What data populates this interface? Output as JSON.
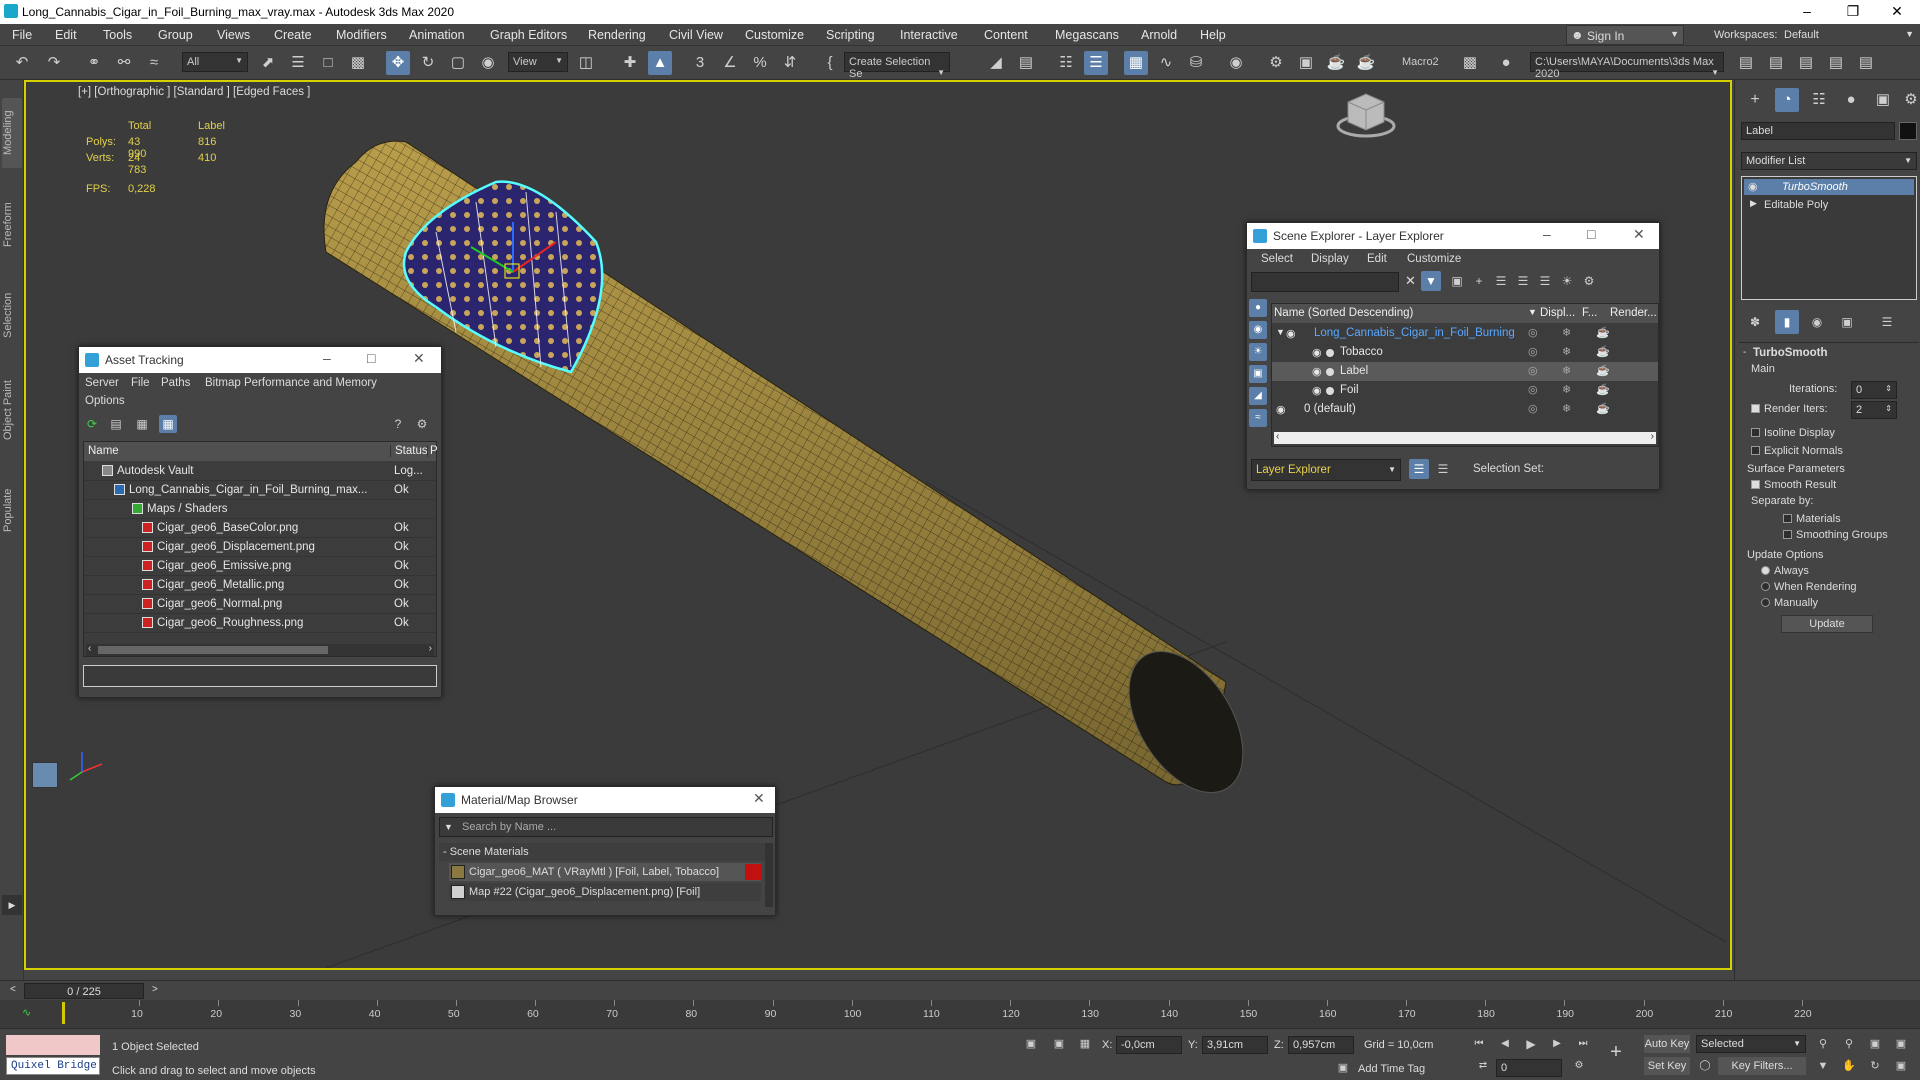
{
  "titlebar": {
    "title": "Long_Cannabis_Cigar_in_Foil_Burning_max_vray.max - Autodesk 3ds Max 2020"
  },
  "menubar": {
    "items": [
      "File",
      "Edit",
      "Tools",
      "Group",
      "Views",
      "Create",
      "Modifiers",
      "Animation",
      "Graph Editors",
      "Rendering",
      "Civil View",
      "Customize",
      "Scripting",
      "Interactive",
      "Content",
      "Megascans",
      "Arnold",
      "Help"
    ],
    "sign_in": "Sign In",
    "workspaces_label": "Workspaces:",
    "workspace_value": "Default"
  },
  "toolbar": {
    "filter_value": "All",
    "ref_coord": "View",
    "selection_set": "Create Selection Se",
    "macro": "Macro2",
    "path": "C:\\Users\\MAYA\\Documents\\3ds Max 2020"
  },
  "left_tabs": [
    "Modeling",
    "Freeform",
    "Selection",
    "Object Paint",
    "Populate"
  ],
  "viewport": {
    "label": "[+] [Orthographic ] [Standard ] [Edged Faces ]",
    "stats": {
      "total_label": "Total",
      "label_label": "Label",
      "polys_label": "Polys:",
      "polys_total": "43 990",
      "polys_label_val": "816",
      "verts_label": "Verts:",
      "verts_total": "24 783",
      "verts_label_val": "410",
      "fps_label": "FPS:",
      "fps_value": "0,228"
    }
  },
  "asset_tracking": {
    "title": "Asset Tracking",
    "menu": [
      "Server",
      "File",
      "Paths",
      "Bitmap Performance and Memory",
      "Options"
    ],
    "columns": [
      "Name",
      "Status",
      "P"
    ],
    "rows": [
      {
        "name": "Autodesk Vault",
        "status": "Log..."
      },
      {
        "name": "Long_Cannabis_Cigar_in_Foil_Burning_max...",
        "status": "Ok"
      },
      {
        "name": "Maps / Shaders",
        "status": ""
      },
      {
        "name": "Cigar_geo6_BaseColor.png",
        "status": "Ok"
      },
      {
        "name": "Cigar_geo6_Displacement.png",
        "status": "Ok"
      },
      {
        "name": "Cigar_geo6_Emissive.png",
        "status": "Ok"
      },
      {
        "name": "Cigar_geo6_Metallic.png",
        "status": "Ok"
      },
      {
        "name": "Cigar_geo6_Normal.png",
        "status": "Ok"
      },
      {
        "name": "Cigar_geo6_Roughness.png",
        "status": "Ok"
      }
    ]
  },
  "scene_explorer": {
    "title": "Scene Explorer - Layer Explorer",
    "menu": [
      "Select",
      "Display",
      "Edit",
      "Customize"
    ],
    "columns": [
      "Name (Sorted Descending)",
      "Displ...",
      "F...",
      "Render..."
    ],
    "rows": [
      {
        "name": "Long_Cannabis_Cigar_in_Foil_Burning"
      },
      {
        "name": "Tobacco"
      },
      {
        "name": "Label"
      },
      {
        "name": "Foil"
      },
      {
        "name": "0 (default)"
      }
    ],
    "footer_layer": "Layer Explorer",
    "selection_set_label": "Selection Set:"
  },
  "material_browser": {
    "title": "Material/Map Browser",
    "search_placeholder": "Search by Name ...",
    "section": "- Scene Materials",
    "items": [
      "Cigar_geo6_MAT  ( VRayMtl )  [Foil, Label, Tobacco]",
      "Map #22 (Cigar_geo6_Displacement.png) [Foil]"
    ]
  },
  "right_panel": {
    "object_name": "Label",
    "modifier_list": "Modifier List",
    "stack": [
      "TurboSmooth",
      "Editable Poly"
    ],
    "rollout_title": "TurboSmooth",
    "main_label": "Main",
    "iterations_label": "Iterations:",
    "iterations_value": "0",
    "render_iters_label": "Render Iters:",
    "render_iters_value": "2",
    "isoline": "Isoline Display",
    "explicit_normals": "Explicit Normals",
    "surface_params": "Surface Parameters",
    "smooth_result": "Smooth Result",
    "separate_by": "Separate by:",
    "materials": "Materials",
    "smoothing_groups": "Smoothing Groups",
    "update_options": "Update Options",
    "always": "Always",
    "when_rendering": "When Rendering",
    "manually": "Manually",
    "update_button": "Update"
  },
  "timeline": {
    "frame": "0 / 225",
    "ticks": [
      "10",
      "20",
      "30",
      "40",
      "50",
      "60",
      "70",
      "80",
      "90",
      "100",
      "110",
      "120",
      "130",
      "140",
      "150",
      "160",
      "170",
      "180",
      "190",
      "200",
      "210",
      "220"
    ]
  },
  "status": {
    "quixel": "Quixel Bridge",
    "selected": "1 Object Selected",
    "hint": "Click and drag to select and move objects",
    "x_label": "X:",
    "x_value": "-0,0cm",
    "y_label": "Y:",
    "y_value": "3,91cm",
    "z_label": "Z:",
    "z_value": "0,957cm",
    "grid": "Grid = 10,0cm",
    "add_time_tag": "Add Time Tag",
    "auto_key": "Auto Key",
    "selected_dd": "Selected",
    "set_key": "Set Key",
    "key_filters": "Key Filters...",
    "frame_field": "0"
  }
}
